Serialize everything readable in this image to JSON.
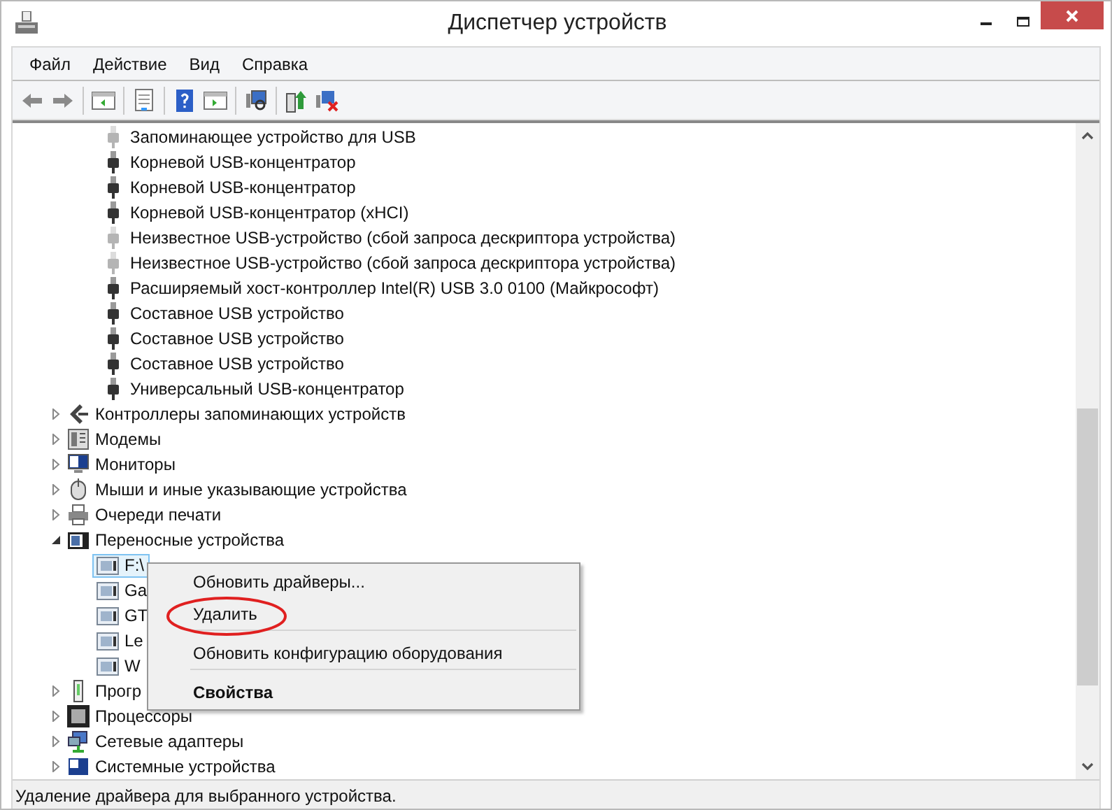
{
  "window": {
    "title": "Диспетчер устройств"
  },
  "menu": [
    "Файл",
    "Действие",
    "Вид",
    "Справка"
  ],
  "usb_devices_continued": [
    {
      "label": "Запоминающее устройство для USB",
      "dimmed": true
    },
    {
      "label": "Корневой USB-концентратор",
      "dimmed": false
    },
    {
      "label": "Корневой USB-концентратор",
      "dimmed": false
    },
    {
      "label": "Корневой USB-концентратор (xHCI)",
      "dimmed": false
    },
    {
      "label": "Неизвестное USB-устройство (сбой запроса дескриптора устройства)",
      "dimmed": true
    },
    {
      "label": "Неизвестное USB-устройство (сбой запроса дескриптора устройства)",
      "dimmed": true
    },
    {
      "label": "Расширяемый хост-контроллер Intel(R) USB 3.0 0100 (Майкрософт)",
      "dimmed": false
    },
    {
      "label": "Составное USB устройство",
      "dimmed": false
    },
    {
      "label": "Составное USB устройство",
      "dimmed": false
    },
    {
      "label": "Составное USB устройство",
      "dimmed": false
    },
    {
      "label": "Универсальный USB-концентратор",
      "dimmed": false
    }
  ],
  "categories": [
    {
      "label": "Контроллеры запоминающих устройств",
      "kind": "storage",
      "expanded": false
    },
    {
      "label": "Модемы",
      "kind": "modem",
      "expanded": false
    },
    {
      "label": "Мониторы",
      "kind": "monitor",
      "expanded": false
    },
    {
      "label": "Мыши и иные указывающие устройства",
      "kind": "mouse",
      "expanded": false
    },
    {
      "label": "Очереди печати",
      "kind": "printer",
      "expanded": false
    },
    {
      "label": "Переносные устройства",
      "kind": "portable",
      "expanded": true,
      "children": [
        {
          "label": "F:\\",
          "selected": true
        },
        {
          "label": "Ga",
          "selected": false
        },
        {
          "label": "GT",
          "selected": false
        },
        {
          "label": "Le",
          "selected": false
        },
        {
          "label": "W",
          "selected": false
        }
      ]
    },
    {
      "label": "Прогр",
      "kind": "program",
      "expanded": false
    },
    {
      "label": "Процессоры",
      "kind": "cpu",
      "expanded": false
    },
    {
      "label": "Сетевые адаптеры",
      "kind": "network",
      "expanded": false
    },
    {
      "label": "Системные устройства",
      "kind": "system",
      "expanded": false
    }
  ],
  "context_menu": [
    {
      "label": "Обновить драйверы...",
      "bold": false,
      "separator_after": false
    },
    {
      "label": "Удалить",
      "bold": false,
      "separator_after": true
    },
    {
      "label": "Обновить конфигурацию оборудования",
      "bold": false,
      "separator_after": true
    },
    {
      "label": "Свойства",
      "bold": true,
      "separator_after": false
    }
  ],
  "status_bar": "Удаление драйвера для выбранного устройства."
}
